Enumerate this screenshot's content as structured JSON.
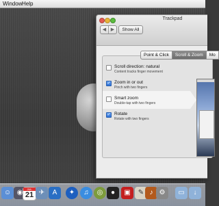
{
  "menubar": {
    "items": [
      "Window",
      "Help"
    ]
  },
  "window": {
    "title": "Trackpad",
    "nav_back": "◀",
    "nav_forward": "▶",
    "show_all": "Show All",
    "tabs": [
      {
        "label": "Point & Click",
        "active": false
      },
      {
        "label": "Scroll & Zoom",
        "active": true
      },
      {
        "label": "Mo",
        "active": false
      }
    ],
    "options": [
      {
        "title": "Scroll direction: natural",
        "subtitle": "Content tracks finger movement",
        "checked": false
      },
      {
        "title": "Zoom in or out",
        "subtitle": "Pinch with two fingers",
        "checked": true
      },
      {
        "title": "Smart zoom",
        "subtitle": "Double-tap with two fingers",
        "checked": false
      },
      {
        "title": "Rotate",
        "subtitle": "Rotate with two fingers",
        "checked": true
      }
    ]
  },
  "dock": {
    "calendar_month": "JUL",
    "calendar_day": "21",
    "icons": [
      "finder-icon",
      "dashboard-icon",
      "calendar-icon",
      "mail-icon",
      "safari-icon",
      "itunes-icon",
      "appstore-icon",
      "preview-icon",
      "photobooth-icon",
      "messages-icon",
      "dvd-icon",
      "textedit-icon",
      "guitar-icon",
      "system-preferences-icon",
      "folder-icon",
      "downloads-icon",
      "trash-icon"
    ]
  },
  "colors": {
    "checkbox_on": "#2d6fd6",
    "active_tab": "#7a7a7a"
  }
}
